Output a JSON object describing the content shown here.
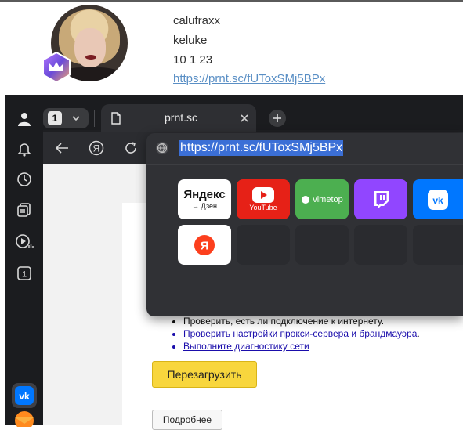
{
  "profile": {
    "name": "calufraxx",
    "login": "keluke",
    "date": "10 1 23",
    "link": "https://prnt.sc/fUToxSMj5BPx"
  },
  "browser": {
    "tab_count": "1",
    "tab_title": "prnt.sc",
    "new_tab_icon": "plus-icon",
    "address_value": "https://prnt.sc/fUToxSMj5BPx",
    "sidebar_counter": "1",
    "sidebar_icons": [
      "user-icon",
      "bell-icon",
      "clock-icon",
      "collections-icon",
      "media-icon",
      "counter-icon",
      "vk-icon",
      "yandex-mail-icon"
    ]
  },
  "speed_dial": [
    {
      "title": "Яндекс",
      "subtitle": "→ Дзен"
    },
    {
      "title": "YouTube"
    },
    {
      "title": "vimetop"
    },
    {
      "title": "Twitch"
    },
    {
      "title": "VK"
    },
    {
      "title": "Я"
    }
  ],
  "error_page": {
    "items": [
      "Проверить, есть ли подключение к интернету.",
      "Проверить настройки прокси-сервера и брандмауэра",
      "Выполните диагностику сети"
    ],
    "trailing_dot": ".",
    "reload_label": "Перезагрузить",
    "details_label": "Подробнее"
  },
  "colors": {
    "accent_yellow": "#f8d63d",
    "selection_blue": "#3b6fd6",
    "youtube_red": "#e62117",
    "vimetop_green": "#4caf50",
    "twitch_purple": "#9146ff",
    "vk_blue": "#0077ff"
  }
}
